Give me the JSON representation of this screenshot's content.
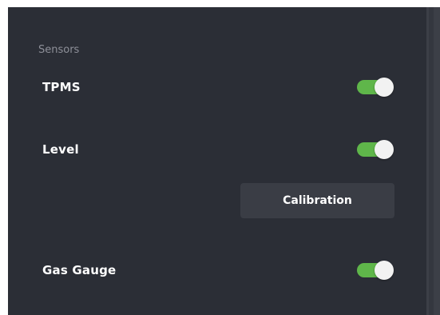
{
  "section": {
    "title": "Sensors"
  },
  "settings": [
    {
      "label": "TPMS",
      "enabled": true
    },
    {
      "label": "Level",
      "enabled": true
    },
    {
      "label": "Gas Gauge",
      "enabled": true
    }
  ],
  "level": {
    "calibration_label": "Calibration"
  },
  "colors": {
    "panel_bg": "#2b2e36",
    "toggle_on": "#5fb64a",
    "button_bg": "#3a3d45"
  }
}
